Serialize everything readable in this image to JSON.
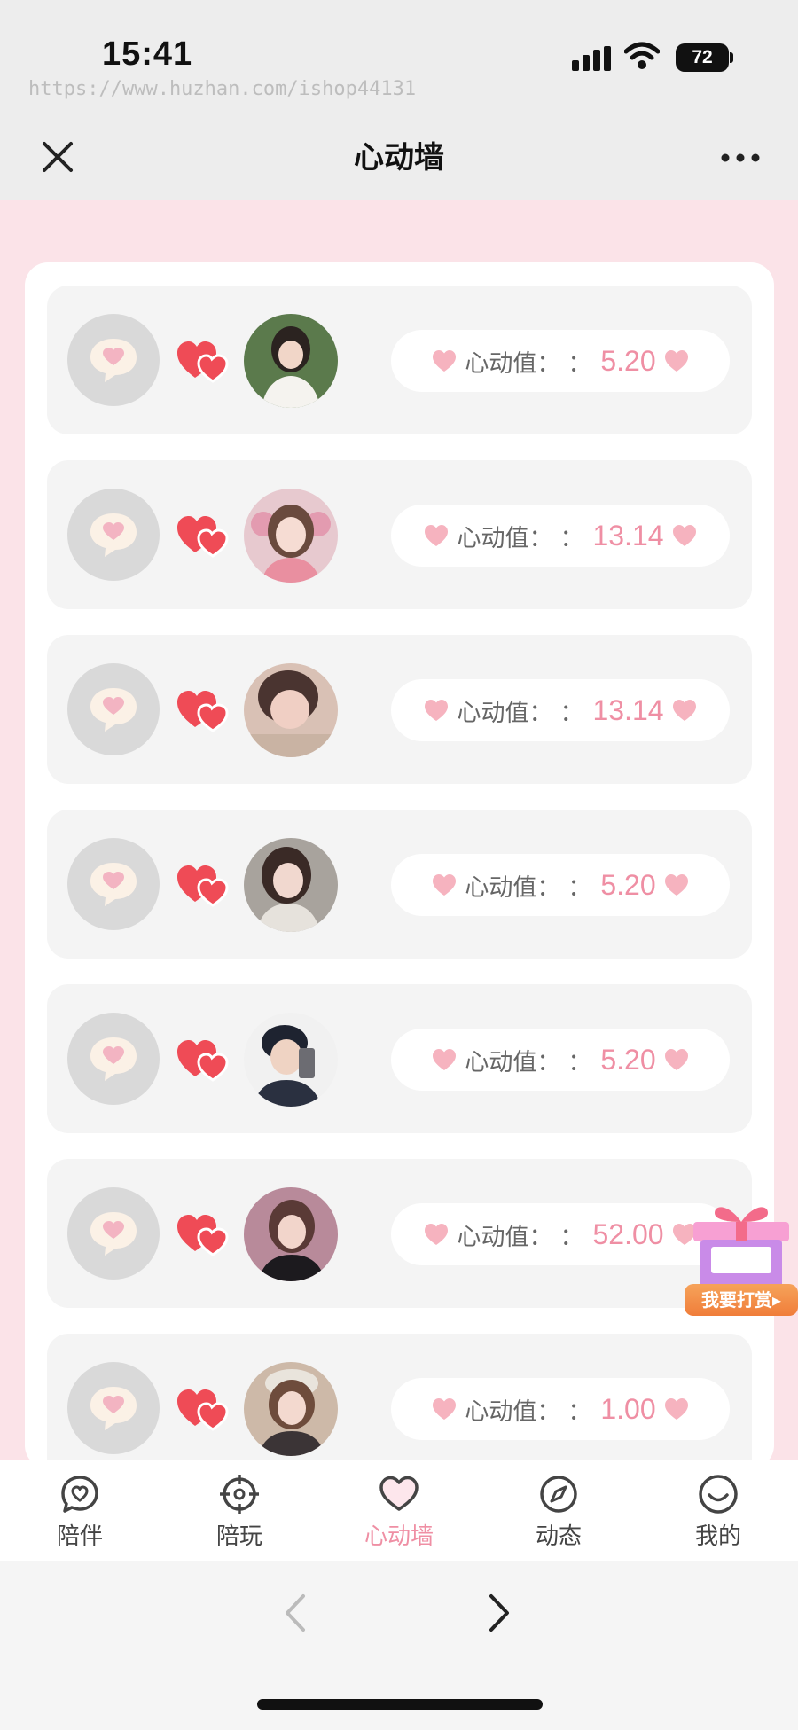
{
  "status_bar": {
    "time": "15:41",
    "battery": "72",
    "watermark": "https://www.huzhan.com/ishop44131"
  },
  "header": {
    "title": "心动墙"
  },
  "rows": [
    {
      "label": "心动值：",
      "sep": "：",
      "value": "5.20"
    },
    {
      "label": "心动值：",
      "sep": "：",
      "value": "13.14"
    },
    {
      "label": "心动值：",
      "sep": "：",
      "value": "13.14"
    },
    {
      "label": "心动值：",
      "sep": "：",
      "value": "5.20"
    },
    {
      "label": "心动值：",
      "sep": "：",
      "value": "5.20"
    },
    {
      "label": "心动值：",
      "sep": "：",
      "value": "52.00"
    },
    {
      "label": "心动值：",
      "sep": "：",
      "value": "1.00"
    }
  ],
  "gift": {
    "label": "我要打赏▸"
  },
  "tabs": [
    {
      "label": "陪伴",
      "icon": "heart-chat-icon",
      "active": false
    },
    {
      "label": "陪玩",
      "icon": "crosshair-icon",
      "active": false
    },
    {
      "label": "心动墙",
      "icon": "heart-icon",
      "active": true
    },
    {
      "label": "动态",
      "icon": "compass-icon",
      "active": false
    },
    {
      "label": "我的",
      "icon": "smile-icon",
      "active": false
    }
  ],
  "colors": {
    "accent": "#ef8fa4",
    "page_bg": "#fbe3e8",
    "row_bg": "#f4f4f4"
  }
}
